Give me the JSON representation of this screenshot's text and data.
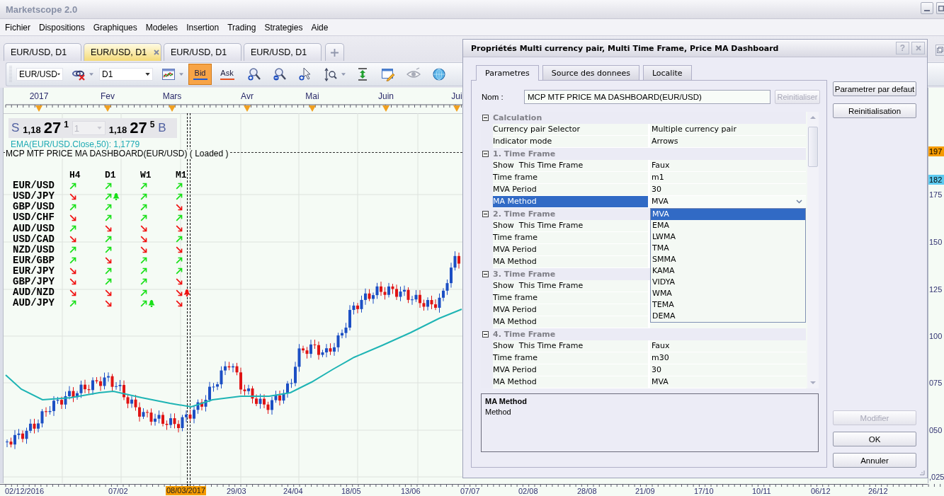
{
  "window": {
    "title": "Marketscope 2.0"
  },
  "menu": [
    "Fichier",
    "Dispositions",
    "Graphiques",
    "Modeles",
    "Insertion",
    "Trading",
    "Strategies",
    "Aide"
  ],
  "chart_tabs": [
    {
      "label": "EUR/USD, D1",
      "selected": false
    },
    {
      "label": "EUR/USD, D1",
      "selected": true
    },
    {
      "label": "EUR/USD, D1",
      "selected": false
    },
    {
      "label": "EUR/USD, D1",
      "selected": false
    }
  ],
  "toolbar": {
    "symbol": "EUR/USD",
    "timeframe": "D1",
    "price_buttons": [
      {
        "label": "Bid",
        "selected": true,
        "color": "#1e5ad2"
      },
      {
        "label": "Ask",
        "selected": false,
        "color": "#e8501e"
      }
    ]
  },
  "chart": {
    "months": [
      "2017",
      "Fev",
      "Mars",
      "Avr",
      "Mai",
      "Juin",
      "Jui"
    ],
    "quote": {
      "sell_label": "S",
      "sell_price": {
        "handle": "1,18",
        "pips": "27",
        "fraction": "1"
      },
      "amount": {
        "value": "1",
        "disabled": true
      },
      "buy_price": {
        "handle": "1,18",
        "pips": "27",
        "fraction": "5"
      },
      "buy_label": "B"
    },
    "ema_label": "EMA(EUR/USD.Close,50): 1,1779",
    "indicator_label": "MCP MTF PRICE MA DASHBOARD(EUR/USD) ( Loaded )",
    "dashboard": {
      "columns": [
        "H4",
        "D1",
        "W1",
        "M1"
      ],
      "rows": [
        {
          "pair": "EUR/USD",
          "signals": [
            {
              "rising": true,
              "alert": false
            },
            {
              "rising": true,
              "alert": false
            },
            {
              "rising": true,
              "alert": false
            },
            {
              "rising": true,
              "alert": false
            }
          ]
        },
        {
          "pair": "USD/JPY",
          "signals": [
            {
              "rising": false,
              "alert": false
            },
            {
              "rising": true,
              "alert": true
            },
            {
              "rising": true,
              "alert": false
            },
            {
              "rising": true,
              "alert": false
            }
          ]
        },
        {
          "pair": "GBP/USD",
          "signals": [
            {
              "rising": true,
              "alert": false
            },
            {
              "rising": true,
              "alert": false
            },
            {
              "rising": true,
              "alert": false
            },
            {
              "rising": false,
              "alert": false
            }
          ]
        },
        {
          "pair": "USD/CHF",
          "signals": [
            {
              "rising": false,
              "alert": false
            },
            {
              "rising": true,
              "alert": false
            },
            {
              "rising": true,
              "alert": false
            },
            {
              "rising": true,
              "alert": false
            }
          ]
        },
        {
          "pair": "AUD/USD",
          "signals": [
            {
              "rising": true,
              "alert": false
            },
            {
              "rising": false,
              "alert": false
            },
            {
              "rising": false,
              "alert": false
            },
            {
              "rising": false,
              "alert": false
            }
          ]
        },
        {
          "pair": "USD/CAD",
          "signals": [
            {
              "rising": false,
              "alert": false
            },
            {
              "rising": true,
              "alert": false
            },
            {
              "rising": false,
              "alert": false
            },
            {
              "rising": true,
              "alert": false
            }
          ]
        },
        {
          "pair": "NZD/USD",
          "signals": [
            {
              "rising": true,
              "alert": false
            },
            {
              "rising": true,
              "alert": false
            },
            {
              "rising": false,
              "alert": false
            },
            {
              "rising": false,
              "alert": false
            }
          ]
        },
        {
          "pair": "EUR/GBP",
          "signals": [
            {
              "rising": true,
              "alert": false
            },
            {
              "rising": false,
              "alert": false
            },
            {
              "rising": true,
              "alert": false
            },
            {
              "rising": true,
              "alert": false
            }
          ]
        },
        {
          "pair": "EUR/JPY",
          "signals": [
            {
              "rising": false,
              "alert": false
            },
            {
              "rising": true,
              "alert": false
            },
            {
              "rising": true,
              "alert": false
            },
            {
              "rising": true,
              "alert": false
            }
          ]
        },
        {
          "pair": "GBP/JPY",
          "signals": [
            {
              "rising": false,
              "alert": false
            },
            {
              "rising": true,
              "alert": false
            },
            {
              "rising": true,
              "alert": false
            },
            {
              "rising": false,
              "alert": false
            }
          ]
        },
        {
          "pair": "AUD/NZD",
          "signals": [
            {
              "rising": false,
              "alert": false
            },
            {
              "rising": false,
              "alert": false
            },
            {
              "rising": true,
              "alert": false
            },
            {
              "rising": false,
              "alert": true
            }
          ]
        },
        {
          "pair": "AUD/JPY",
          "signals": [
            {
              "rising": true,
              "alert": false
            },
            {
              "rising": false,
              "alert": false
            },
            {
              "rising": true,
              "alert": true
            },
            {
              "rising": false,
              "alert": false
            }
          ]
        }
      ]
    },
    "price_axis": [
      {
        "label": "197",
        "kind": "bid"
      },
      {
        "label": "182",
        "kind": "ema"
      },
      {
        "label": "175",
        "kind": "tick"
      },
      {
        "label": "150",
        "kind": "tick"
      },
      {
        "label": "125",
        "kind": "tick"
      },
      {
        "label": "100",
        "kind": "tick"
      },
      {
        "label": "075",
        "kind": "tick"
      },
      {
        "label": "050",
        "kind": "tick"
      },
      {
        "label": ",025",
        "kind": "tick"
      }
    ],
    "date_axis": [
      {
        "label": "02/12/2016",
        "kind": "tick"
      },
      {
        "label": "07/02",
        "kind": "tick"
      },
      {
        "label": "08/03/2017",
        "kind": "cursor"
      },
      {
        "label": "29/03",
        "kind": "tick"
      },
      {
        "label": "24/04",
        "kind": "tick"
      },
      {
        "label": "18/05",
        "kind": "tick"
      },
      {
        "label": "13/06",
        "kind": "tick"
      },
      {
        "label": "07/07",
        "kind": "tick"
      },
      {
        "label": "02/08",
        "kind": "tick"
      },
      {
        "label": "28/08",
        "kind": "tick"
      },
      {
        "label": "21/09",
        "kind": "tick"
      },
      {
        "label": "17/10",
        "kind": "tick"
      },
      {
        "label": "10/11",
        "kind": "tick"
      },
      {
        "label": "06/12",
        "kind": "tick"
      },
      {
        "label": "26/12",
        "kind": "tick"
      }
    ]
  },
  "dialog": {
    "title": "Propriétés Multi currency pair, Multi Time Frame, Price MA Dashboard",
    "help_button": "?",
    "tabs": [
      {
        "label": "Parametres",
        "selected": true
      },
      {
        "label": "Source des donnees",
        "selected": false
      },
      {
        "label": "Localite",
        "selected": false
      }
    ],
    "name_label": "Nom :",
    "name_value": "MCP MTF PRICE MA DASHBOARD(EUR/USD)",
    "name_reset": {
      "label": "Reinitialiser",
      "disabled": true
    },
    "properties": [
      {
        "category": "Calculation",
        "expanded": true,
        "items": [
          {
            "name": "Currency pair Selector",
            "value": "Multiple currency pair",
            "selected": false
          },
          {
            "name": "Indicator mode",
            "value": "Arrows",
            "selected": false
          }
        ]
      },
      {
        "category": "1. Time Frame",
        "expanded": true,
        "items": [
          {
            "name": "Show  This Time Frame",
            "value": "Faux",
            "selected": false
          },
          {
            "name": "Time frame",
            "value": "m1",
            "selected": false
          },
          {
            "name": "MVA Period",
            "value": "30",
            "selected": false
          },
          {
            "name": "MA Method",
            "value": "MVA",
            "selected": true,
            "options": [
              {
                "label": "MVA",
                "selected": true
              },
              {
                "label": "EMA",
                "selected": false
              },
              {
                "label": "LWMA",
                "selected": false
              },
              {
                "label": "TMA",
                "selected": false
              },
              {
                "label": "SMMA",
                "selected": false
              },
              {
                "label": "KAMA",
                "selected": false
              },
              {
                "label": "VIDYA",
                "selected": false
              },
              {
                "label": "WMA",
                "selected": false
              },
              {
                "label": "TEMA",
                "selected": false
              },
              {
                "label": "DEMA",
                "selected": false
              }
            ]
          }
        ]
      },
      {
        "category": "2. Time Frame",
        "expanded": true,
        "items": [
          {
            "name": "Show  This Time Frame",
            "selected": false
          },
          {
            "name": "Time frame",
            "selected": false
          },
          {
            "name": "MVA Period",
            "selected": false
          },
          {
            "name": "MA Method",
            "selected": false
          }
        ]
      },
      {
        "category": "3. Time Frame",
        "expanded": true,
        "items": [
          {
            "name": "Show  This Time Frame",
            "selected": false
          },
          {
            "name": "Time frame",
            "selected": false
          },
          {
            "name": "MVA Period",
            "selected": false
          },
          {
            "name": "MA Method",
            "selected": false
          }
        ]
      },
      {
        "category": "4. Time Frame",
        "expanded": true,
        "items": [
          {
            "name": "Show  This Time Frame",
            "value": "Faux",
            "selected": false
          },
          {
            "name": "Time frame",
            "value": "m30",
            "selected": false
          },
          {
            "name": "MVA Period",
            "value": "30",
            "selected": false
          },
          {
            "name": "MA Method",
            "value": "MVA",
            "selected": false
          }
        ]
      }
    ],
    "description": {
      "title": "MA Method",
      "text": "Method"
    },
    "side_buttons": [
      {
        "label": "Parametrer par defaut",
        "disabled": false
      },
      {
        "label": "Reinitialisation",
        "disabled": false
      }
    ],
    "footer_buttons": [
      {
        "label": "Modifier",
        "disabled": true
      },
      {
        "label": "OK",
        "disabled": false
      },
      {
        "label": "Annuler",
        "disabled": false
      }
    ]
  }
}
